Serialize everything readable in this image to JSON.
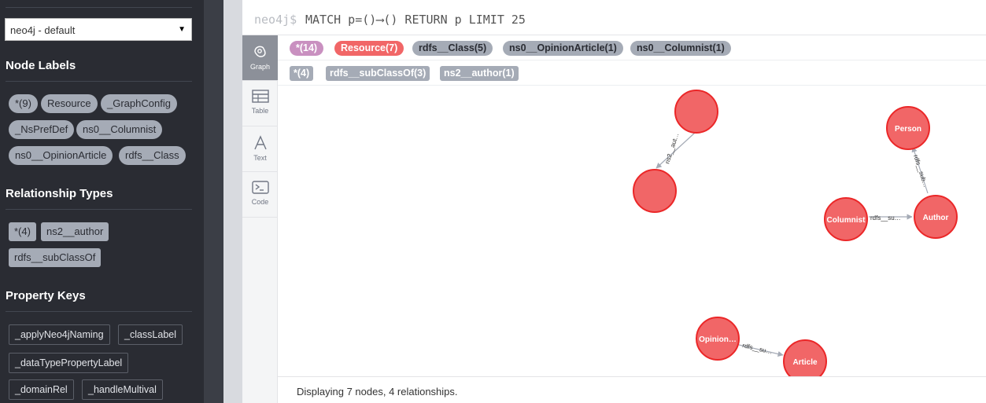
{
  "sidebar": {
    "database": "neo4j - default",
    "node_labels_title": "Node Labels",
    "node_labels": [
      "*(9)",
      "Resource",
      "_GraphConfig",
      "_NsPrefDef",
      "ns0__Columnist",
      "ns0__OpinionArticle",
      "rdfs__Class"
    ],
    "relationship_types_title": "Relationship Types",
    "relationship_types": [
      "*(4)",
      "ns2__author",
      "rdfs__subClassOf"
    ],
    "property_keys_title": "Property Keys",
    "property_keys": [
      "_applyNeo4jNaming",
      "_classLabel",
      "_dataTypePropertyLabel",
      "_domainRel",
      "_handleMultival"
    ]
  },
  "editor": {
    "prompt": "neo4j$",
    "query": "MATCH p=()⟶() RETURN p LIMIT 25"
  },
  "view_tabs": [
    "Graph",
    "Table",
    "Text",
    "Code"
  ],
  "result": {
    "label_chips": [
      "*(14)",
      "Resource(7)",
      "rdfs__Class(5)",
      "ns0__OpinionArticle(1)",
      "ns0__Columnist(1)"
    ],
    "rel_chips": [
      "*(4)",
      "rdfs__subClassOf(3)",
      "ns2__author(1)"
    ],
    "status": "Displaying 7 nodes, 4 relationships."
  },
  "graph": {
    "nodes": [
      "",
      "",
      "Person",
      "Columnist",
      "Author",
      "Opinion…",
      "Article"
    ],
    "edges": [
      "ns2__aut…",
      "rdfs__sub…",
      "rdfs__su…",
      "rdfs__su…"
    ]
  },
  "colors": {
    "node_fill": "#f16667",
    "node_stroke": "#eb2728",
    "all_label_chip": "#c990c0",
    "resource_chip": "#f16667",
    "gray_chip": "#a5abb6",
    "sidebar_bg": "#2a2c33"
  }
}
